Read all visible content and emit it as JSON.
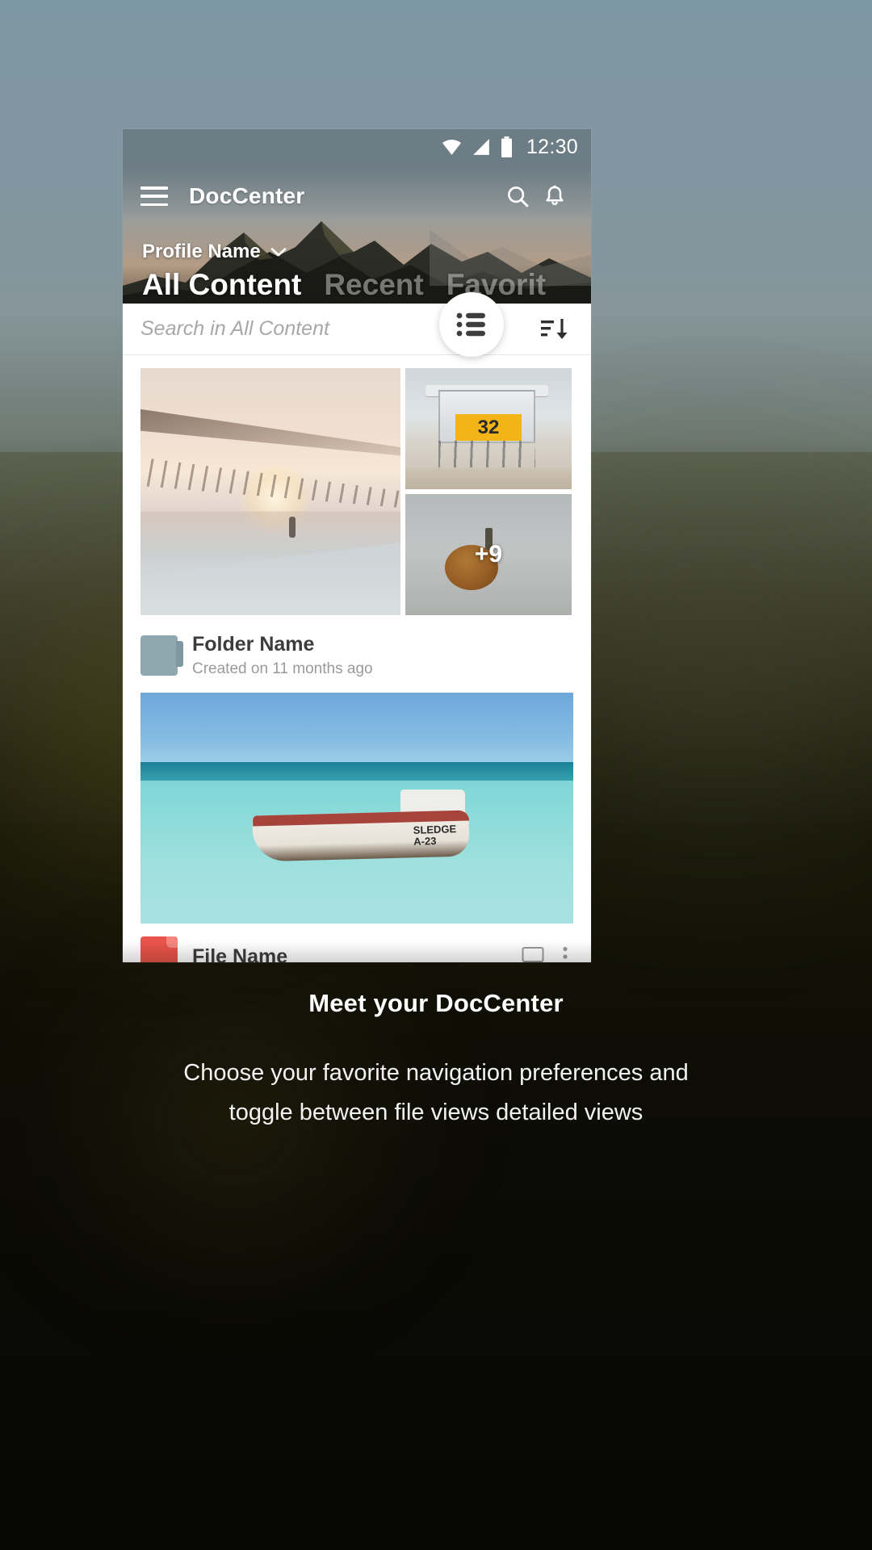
{
  "statusbar": {
    "time": "12:30",
    "icons": [
      "wifi-icon",
      "signal-icon",
      "battery-icon"
    ]
  },
  "appbar": {
    "menu_icon": "hamburger-menu-icon",
    "title": "DocCenter",
    "search_icon": "search-icon",
    "notifications_icon": "bell-icon"
  },
  "profile": {
    "name": "Profile Name",
    "chevron_icon": "chevron-down-icon"
  },
  "tabs": [
    {
      "label": "All Content",
      "active": true
    },
    {
      "label": "Recent",
      "active": false
    },
    {
      "label": "Favorit",
      "active": false
    }
  ],
  "search": {
    "placeholder": "Search in All Content",
    "value": "",
    "view_toggle_icon": "list-view-icon",
    "sort_icon": "sort-descending-icon"
  },
  "collage": {
    "overflow_badge": "+9",
    "tower_number": "32",
    "tiles": [
      {
        "name": "pier-sunset-photo"
      },
      {
        "name": "lifeguard-tower-photo"
      },
      {
        "name": "pumpkin-photo"
      }
    ]
  },
  "folder_item": {
    "icon": "folder-icon",
    "title": "Folder Name",
    "subtitle": "Created on 11 months ago"
  },
  "file_item": {
    "icon": "pdf-file-icon",
    "title": "File Name",
    "comment_icon": "comment-icon",
    "more_icon": "more-vertical-icon",
    "photo_name": "boat-ocean-photo",
    "photo_text": "SLEDGE\nA-23"
  },
  "caption": {
    "title": "Meet your DocCenter",
    "line1": "Choose your favorite navigation preferences and",
    "line2": "toggle between file views detailed views"
  },
  "colors": {
    "statusbar": "#6d7d85",
    "accent_yellow": "#f3b417",
    "folder": "#8fa8b0",
    "file_red": "#e8534a"
  }
}
